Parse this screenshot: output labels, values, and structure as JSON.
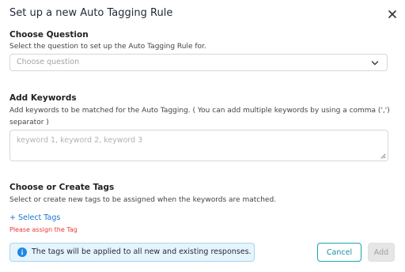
{
  "modal": {
    "title": "Set up a new Auto Tagging Rule"
  },
  "question": {
    "title": "Choose Question",
    "description": "Select the question to set up the Auto Tagging Rule for.",
    "placeholder": "Choose question"
  },
  "keywords": {
    "title": "Add Keywords",
    "description_line1": "Add keywords to be matched for the Auto Tagging. ( You can add multiple keywords by using a comma (',')",
    "description_line2": "separator )",
    "placeholder": "keyword 1, keyword 2, keyword 3"
  },
  "tags": {
    "title": "Choose or Create Tags",
    "description": "Select or create new tags to be assigned when the keywords are matched.",
    "select_link": "+ Select Tags",
    "error": "Please assign the Tag"
  },
  "info": {
    "message": "The tags will be applied to all new and existing responses."
  },
  "buttons": {
    "cancel": "Cancel",
    "add": "Add"
  },
  "colors": {
    "accent": "#1aa3b3",
    "link": "#1976d2",
    "error": "#e53935",
    "info_bg": "#e6f4fc",
    "info_icon": "#1e88e5"
  }
}
